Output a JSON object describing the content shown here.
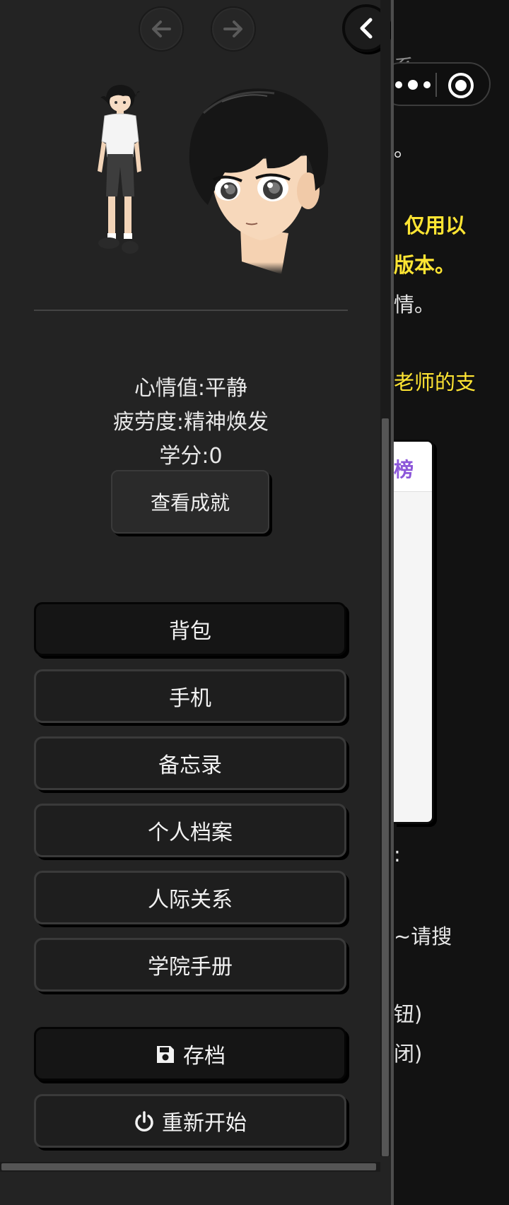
{
  "nav": {
    "back_icon": "arrow-left-icon",
    "forward_icon": "arrow-right-icon",
    "collapse_icon": "chevron-left-icon"
  },
  "status": {
    "mood": "心情值:平静",
    "fatigue": "疲劳度:精神焕发",
    "credits": "学分:0"
  },
  "achievements_button": "查看成就",
  "menu": [
    {
      "label": "背包"
    },
    {
      "label": "手机"
    },
    {
      "label": "备忘录"
    },
    {
      "label": "个人档案"
    },
    {
      "label": "人际关系"
    },
    {
      "label": "学院手册"
    }
  ],
  "save_button": {
    "label": "存档",
    "icon": "floppy-disk-icon"
  },
  "restart_button": {
    "label": "重新开始",
    "icon": "power-icon"
  },
  "background_story": {
    "lines": [
      "系",
      "。",
      "仅用以",
      "版本。",
      "情。",
      "老师的支",
      ":",
      "~请搜",
      "钮)",
      "闭)"
    ],
    "rank_card_title": "榜"
  },
  "mini_program_capsule": {
    "more_icon": "more-dots-icon",
    "close_icon": "target-close-icon"
  },
  "colors": {
    "panel_bg": "#232323",
    "button_bg": "#1e1e1e",
    "highlight_yellow": "#ffe533",
    "rank_title_purple": "#8c57d9"
  }
}
